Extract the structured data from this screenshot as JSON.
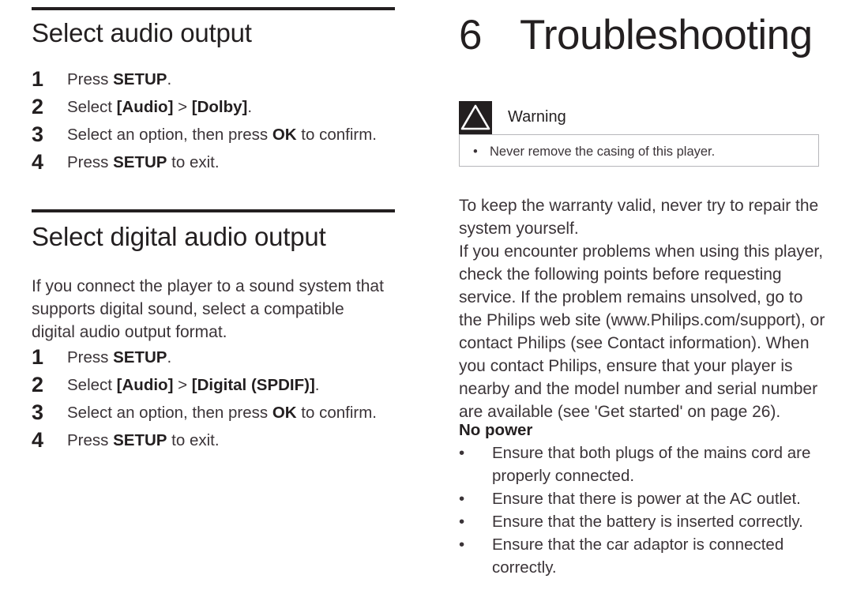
{
  "left_column": {
    "section_1": {
      "heading": "Select audio output",
      "steps": [
        {
          "number": "1",
          "parts": [
            {
              "text": "Press ",
              "bold": false
            },
            {
              "text": "SETUP",
              "bold": true
            },
            {
              "text": ".",
              "bold": false
            }
          ]
        },
        {
          "number": "2",
          "parts": [
            {
              "text": "Select ",
              "bold": false
            },
            {
              "text": "[Audio]",
              "bold": true
            },
            {
              "text": " > ",
              "bold": false
            },
            {
              "text": "[Dolby]",
              "bold": true
            },
            {
              "text": ".",
              "bold": false
            }
          ]
        },
        {
          "number": "3",
          "parts": [
            {
              "text": "Select an option, then press ",
              "bold": false
            },
            {
              "text": "OK",
              "bold": true
            },
            {
              "text": " to confirm.",
              "bold": false
            }
          ]
        },
        {
          "number": "4",
          "parts": [
            {
              "text": "Press ",
              "bold": false
            },
            {
              "text": "SETUP",
              "bold": true
            },
            {
              "text": " to exit.",
              "bold": false
            }
          ]
        }
      ]
    },
    "section_2": {
      "heading": "Select digital audio output",
      "intro_lines": [
        "If you connect the player to a sound system that",
        "supports digital sound, select a compatible digital",
        "audio output format."
      ],
      "steps": [
        {
          "number": "1",
          "parts": [
            {
              "text": "Press ",
              "bold": false
            },
            {
              "text": "SETUP",
              "bold": true
            },
            {
              "text": ".",
              "bold": false
            }
          ]
        },
        {
          "number": "2",
          "parts": [
            {
              "text": "Select ",
              "bold": false
            },
            {
              "text": "[Audio]",
              "bold": true
            },
            {
              "text": " > ",
              "bold": false
            },
            {
              "text": "[Digital (SPDIF)]",
              "bold": true
            },
            {
              "text": ".",
              "bold": false
            }
          ]
        },
        {
          "number": "3",
          "parts": [
            {
              "text": "Select an option, then press ",
              "bold": false
            },
            {
              "text": "OK",
              "bold": true
            },
            {
              "text": " to confirm.",
              "bold": false
            }
          ]
        },
        {
          "number": "4",
          "parts": [
            {
              "text": "Press ",
              "bold": false
            },
            {
              "text": "SETUP",
              "bold": true
            },
            {
              "text": " to exit.",
              "bold": false
            }
          ]
        }
      ]
    }
  },
  "right_column": {
    "chapter_number": "6",
    "chapter_title": "Troubleshooting",
    "warning": {
      "icon": "warning-triangle-icon",
      "label": "Warning",
      "bullet_glyph": "•",
      "items": [
        "Never remove the casing of this player."
      ]
    },
    "body_lines": [
      "To keep the warranty valid, never try to repair the",
      "system yourself.",
      "If you encounter problems when using this player,",
      "check the following points before requesting",
      "service. If the problem remains unsolved, go to",
      "the Philips web site (www.Philips.com/support), or",
      "contact Philips (see Contact information). When",
      "you contact Philips, ensure that your player is",
      "nearby and the model number and serial number",
      "are available (see 'Get started' on page 26)."
    ],
    "subheading": "No power",
    "bullet_glyph": "•",
    "bullets": [
      [
        "Ensure that both plugs of the mains cord are",
        "properly connected."
      ],
      [
        "Ensure that there is power at the AC outlet."
      ],
      [
        "Ensure that the battery is inserted correctly."
      ],
      [
        "Ensure that the car adaptor is connected",
        "correctly."
      ]
    ]
  },
  "colors": {
    "ink": "#231f20",
    "body_text": "#3b3438",
    "rule": "#231f20",
    "box_border": "#b7b7ba",
    "icon_background": "#231f20",
    "page_background": "#ffffff"
  }
}
